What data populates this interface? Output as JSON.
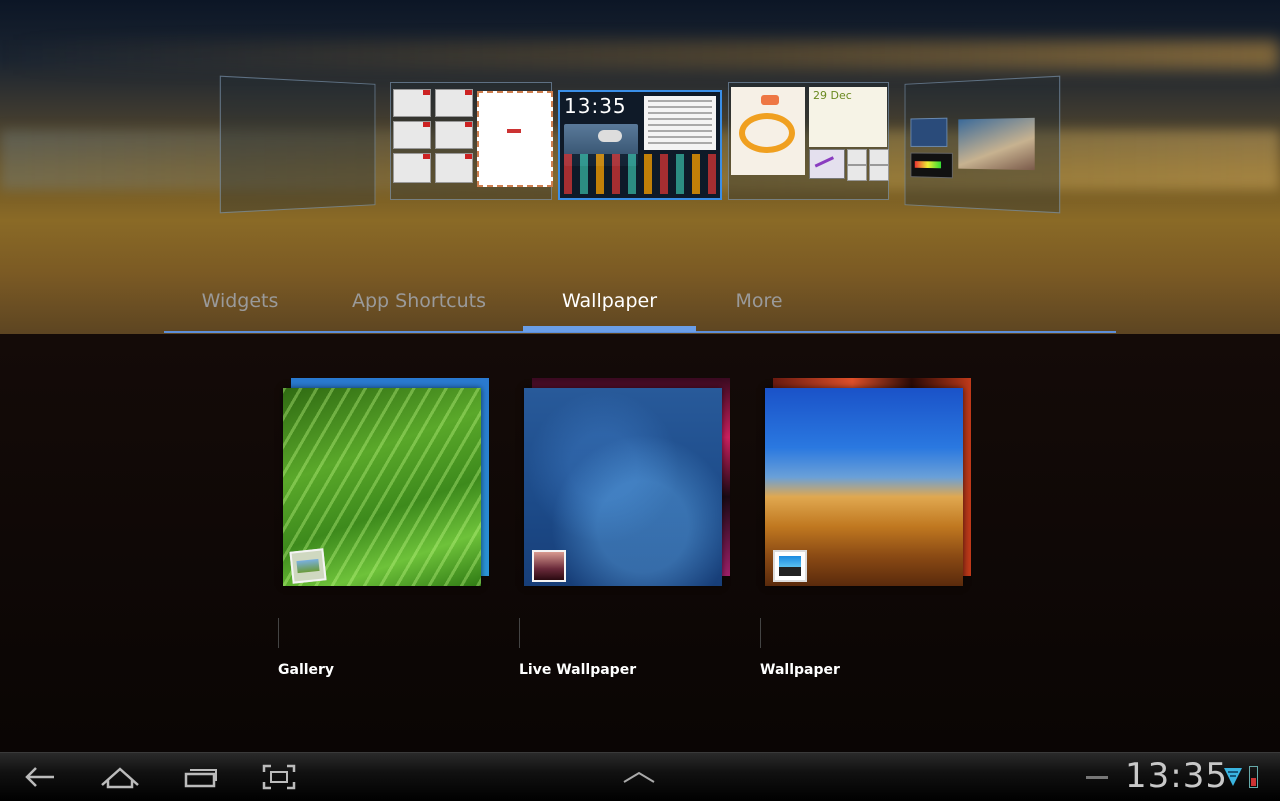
{
  "tabs": [
    {
      "label": "Widgets"
    },
    {
      "label": "App Shortcuts"
    },
    {
      "label": "Wallpaper"
    },
    {
      "label": "More"
    }
  ],
  "active_tab": "Wallpaper",
  "homescreens": {
    "center_clock": "13:35",
    "calendar_date": "29 Dec"
  },
  "choices": [
    {
      "label": "Gallery",
      "badge_icon": "gallery-icon"
    },
    {
      "label": "Live Wallpaper",
      "badge_icon": "live-wallpaper-icon"
    },
    {
      "label": "Wallpaper",
      "badge_icon": "wallpaper-icon"
    }
  ],
  "system_bar": {
    "clock": "13:35",
    "icons": [
      "back-icon",
      "home-icon",
      "recent-apps-icon",
      "screenshot-icon",
      "up-arrow-icon",
      "wifi-icon",
      "battery-icon"
    ]
  },
  "colors": {
    "accent": "#5e8fd8",
    "selected_panel_border": "#3a8fe8"
  }
}
